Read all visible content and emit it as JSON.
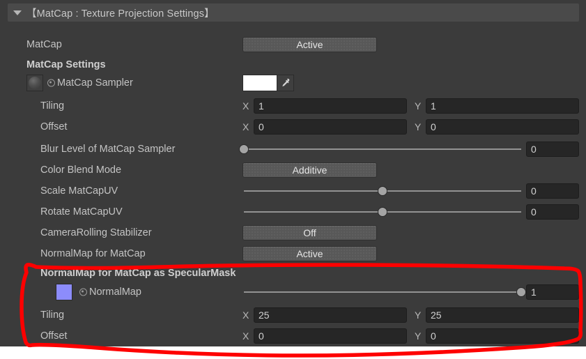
{
  "panel": {
    "background_color": "#3b3b3b",
    "header": {
      "title": "【MatCap : Texture Projection Settings】",
      "foldout_icon": "triangle-down-icon",
      "expanded": "true"
    }
  },
  "annotation": {
    "color": "#fe0000",
    "shape": "hand-drawn-rounded-rectangle",
    "encloses": "NormalMap for MatCap as SpecularMask section"
  },
  "rows": [
    {
      "id": "matcap",
      "label": "MatCap",
      "indent": "ind0",
      "bold": "false",
      "control": "enum",
      "value": "Active"
    },
    {
      "id": "matcap-settings",
      "label": "MatCap Settings",
      "indent": "ind0",
      "bold": "true",
      "control": "none",
      "value": ""
    },
    {
      "id": "matcap-sampler",
      "label": "MatCap Sampler",
      "indent": "ind2",
      "bold": "false",
      "control": "color",
      "value": "#ffffff",
      "thumbnail": "matcap-sphere-thumbnail",
      "glyph": "target-dot-icon",
      "picker_icon": "eyedropper-icon"
    },
    {
      "id": "matcap-sampler-tiling",
      "label": "Tiling",
      "indent": "ind1",
      "bold": "false",
      "control": "vector2",
      "x_label": "X",
      "y_label": "Y",
      "x": "1",
      "y": "1"
    },
    {
      "id": "matcap-sampler-offset",
      "label": "Offset",
      "indent": "ind1",
      "bold": "false",
      "control": "vector2",
      "x_label": "X",
      "y_label": "Y",
      "x": "0",
      "y": "0"
    },
    {
      "id": "blur-level-of-matcap-sampler",
      "label": "Blur Level of MatCap Sampler",
      "indent": "ind1",
      "bold": "false",
      "control": "slider",
      "value": "0",
      "percent": 0
    },
    {
      "id": "color-blend-mode",
      "label": "Color Blend Mode",
      "indent": "ind1",
      "bold": "false",
      "control": "enum",
      "value": "Additive"
    },
    {
      "id": "scale-matcapuv",
      "label": "Scale MatCapUV",
      "indent": "ind1",
      "bold": "false",
      "control": "slider",
      "value": "0",
      "percent": 50
    },
    {
      "id": "rotate-matcapuv",
      "label": "Rotate MatCapUV",
      "indent": "ind1",
      "bold": "false",
      "control": "slider",
      "value": "0",
      "percent": 50
    },
    {
      "id": "camerarolling-stabilizer",
      "label": "CameraRolling Stabilizer",
      "indent": "ind1",
      "bold": "false",
      "control": "enum",
      "value": "Off"
    },
    {
      "id": "normalmap-for-matcap",
      "label": "NormalMap for MatCap",
      "indent": "ind1",
      "bold": "false",
      "control": "enum",
      "value": "Active"
    },
    {
      "id": "normalmap-for-matcap-as-specularmask",
      "label": "NormalMap for MatCap as SpecularMask",
      "indent": "ind1",
      "bold": "true",
      "control": "none",
      "value": ""
    },
    {
      "id": "normalmap",
      "label": "NormalMap",
      "indent": "ind2",
      "bold": "false",
      "control": "slider",
      "value": "1",
      "percent": 100,
      "thumbnail": "normalmap-swatch-thumbnail",
      "thumbnail_color": "#8c8cfb",
      "glyph": "target-dot-icon"
    },
    {
      "id": "normalmap-tiling",
      "label": "Tiling",
      "indent": "ind1",
      "bold": "false",
      "control": "vector2",
      "x_label": "X",
      "y_label": "Y",
      "x": "25",
      "y": "25"
    },
    {
      "id": "normalmap-offset",
      "label": "Offset",
      "indent": "ind1",
      "bold": "false",
      "control": "vector2",
      "x_label": "X",
      "y_label": "Y",
      "x": "0",
      "y": "0"
    }
  ]
}
